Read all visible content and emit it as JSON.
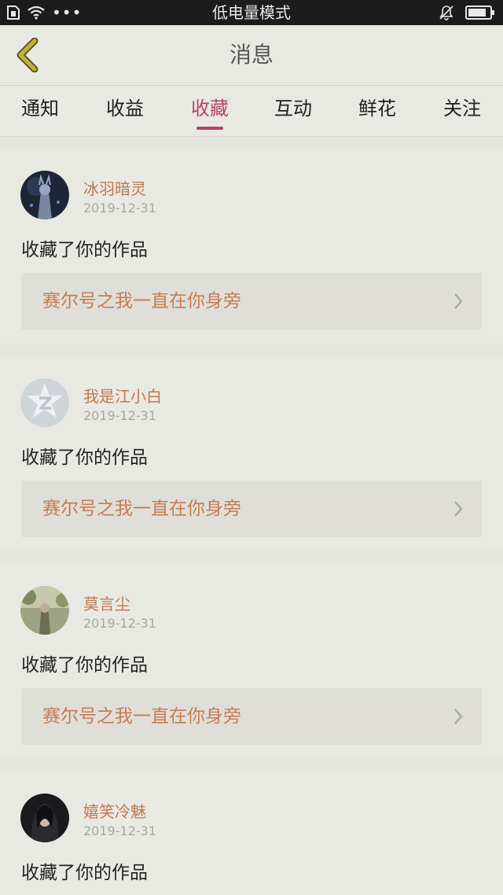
{
  "status_bar": {
    "title": "低电量模式",
    "icons": [
      "sim-icon",
      "wifi-icon",
      "more-dots-icon",
      "mute-bell-icon",
      "battery-icon"
    ],
    "dots": "•••"
  },
  "header": {
    "title": "消息",
    "back_icon": "chevron-left-icon"
  },
  "tabs": [
    {
      "label": "通知",
      "active": false
    },
    {
      "label": "收益",
      "active": false
    },
    {
      "label": "收藏",
      "active": true
    },
    {
      "label": "互动",
      "active": false
    },
    {
      "label": "鲜花",
      "active": false
    },
    {
      "label": "关注",
      "active": false
    }
  ],
  "feed": [
    {
      "name": "冰羽暗灵",
      "date": "2019-12-31",
      "action": "收藏了你的作品",
      "work": "赛尔号之我一直在你身旁"
    },
    {
      "name": "我是江小白",
      "date": "2019-12-31",
      "action": "收藏了你的作品",
      "work": "赛尔号之我一直在你身旁"
    },
    {
      "name": "莫言尘",
      "date": "2019-12-31",
      "action": "收藏了你的作品",
      "work": "赛尔号之我一直在你身旁"
    },
    {
      "name": "嬉笑冷魅",
      "date": "2019-12-31",
      "action": "收藏了你的作品",
      "work": ""
    }
  ],
  "colors": {
    "accent": "#b3426b",
    "username": "#c0774f",
    "work_title": "#c77c54",
    "background": "#e6e6e1",
    "back_icon": "#c2b23c"
  }
}
